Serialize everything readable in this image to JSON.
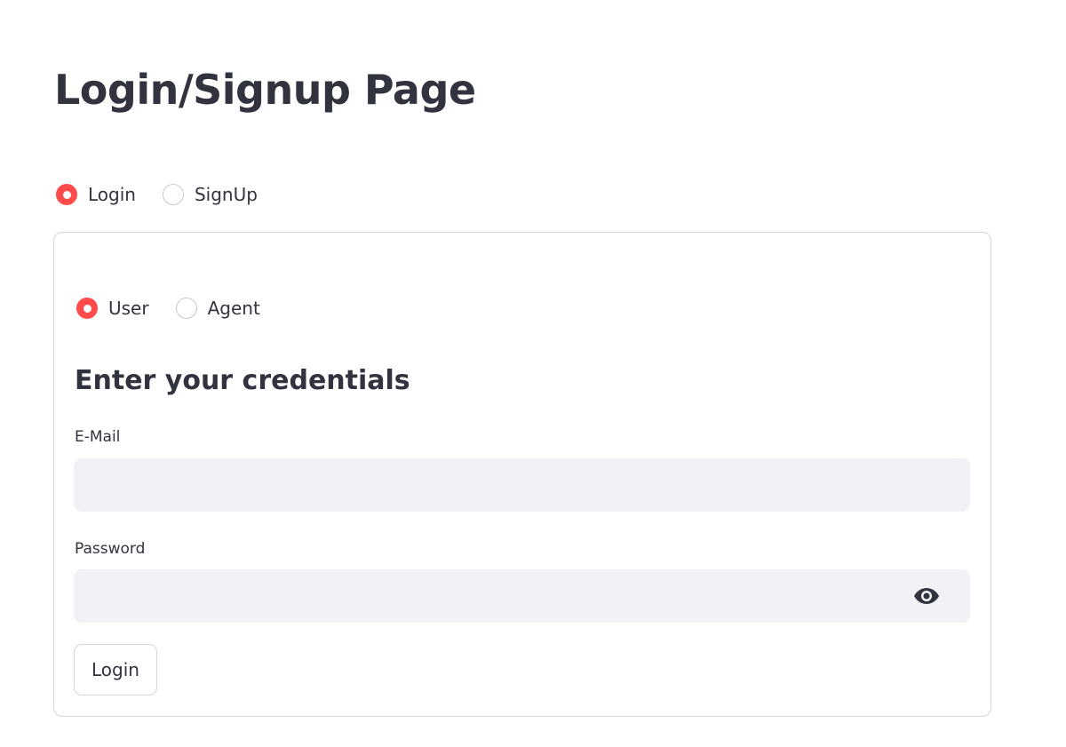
{
  "page": {
    "title": "Login/Signup Page"
  },
  "mode_selector": {
    "options": [
      {
        "label": "Login",
        "selected": true
      },
      {
        "label": "SignUp",
        "selected": false
      }
    ]
  },
  "role_selector": {
    "options": [
      {
        "label": "User",
        "selected": true
      },
      {
        "label": "Agent",
        "selected": false
      }
    ]
  },
  "form": {
    "heading": "Enter your credentials",
    "email": {
      "label": "E-Mail",
      "value": "",
      "placeholder": ""
    },
    "password": {
      "label": "Password",
      "value": "",
      "placeholder": "",
      "toggle_icon": "eye-icon"
    },
    "submit_label": "Login"
  },
  "colors": {
    "accent": "#ff4b4b",
    "text": "#31333f",
    "input_background": "#f0f2f6",
    "border": "#d6d6d9"
  }
}
